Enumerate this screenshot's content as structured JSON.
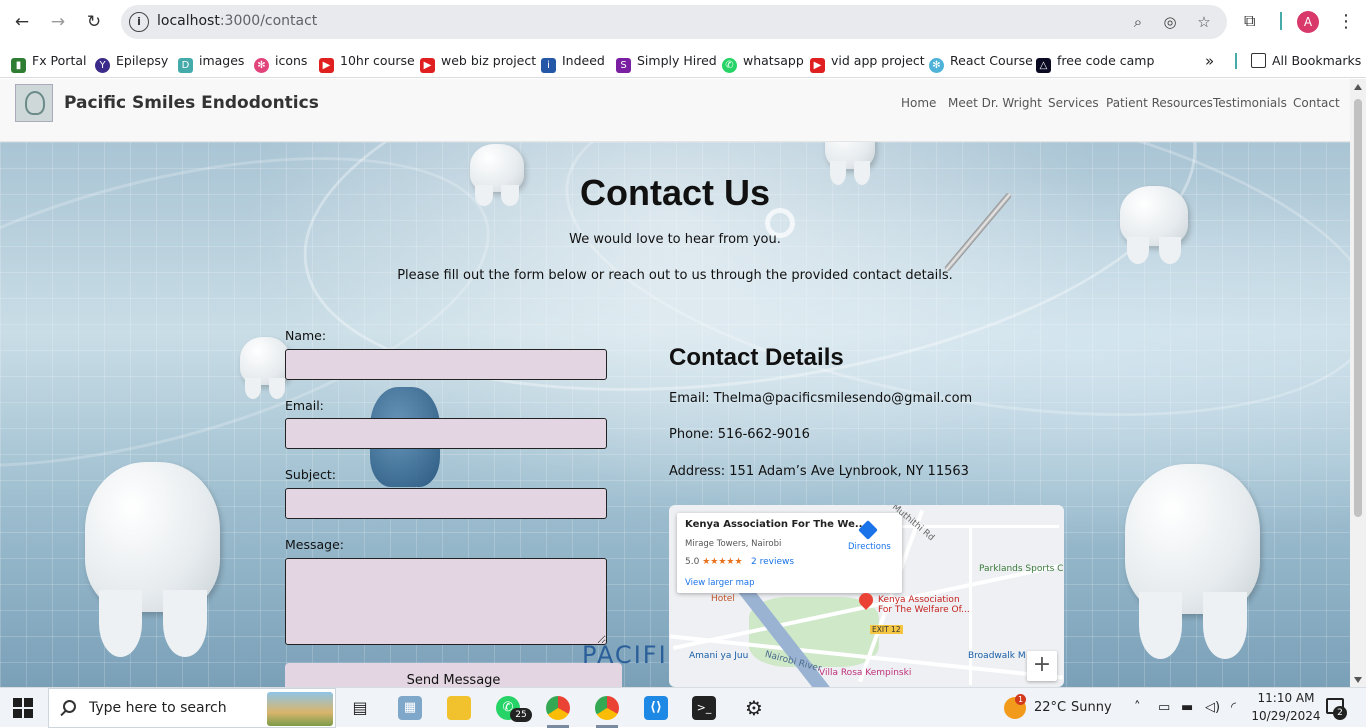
{
  "browser": {
    "url_host": "localhost",
    "url_path": ":3000/contact",
    "profile_initial": "A",
    "bookmarks": [
      {
        "label": "Fx Portal",
        "icon": "bar-chart-icon",
        "color": "#2e7d32"
      },
      {
        "label": "Epilepsy",
        "icon": "yahoo-icon",
        "color": "#3b2a8a"
      },
      {
        "label": "images",
        "icon": "document-icon",
        "color": "#4aa"
      },
      {
        "label": "icons",
        "icon": "react-icon",
        "color": "#e0447a"
      },
      {
        "label": "10hr course",
        "icon": "youtube-icon",
        "color": "#e02020"
      },
      {
        "label": "web biz project",
        "icon": "youtube-icon",
        "color": "#e02020"
      },
      {
        "label": "Indeed",
        "icon": "indeed-icon",
        "color": "#2557a7"
      },
      {
        "label": "Simply Hired",
        "icon": "simplyhired-icon",
        "color": "#7a1fa2"
      },
      {
        "label": "whatsapp",
        "icon": "whatsapp-icon",
        "color": "#25d366"
      },
      {
        "label": "vid app project",
        "icon": "youtube-icon",
        "color": "#e02020"
      },
      {
        "label": "React Course",
        "icon": "react-icon",
        "color": "#4fb3d9"
      },
      {
        "label": "free code camp",
        "icon": "freecodecamp-icon",
        "color": "#0a0a23"
      }
    ],
    "bookmarks_overflow": "»",
    "all_bookmarks": "All Bookmarks"
  },
  "site": {
    "brand": "Pacific Smiles Endodontics",
    "nav": [
      "Home",
      "Meet Dr. Wright",
      "Services",
      "Patient Resources",
      "Testimonials",
      "Contact"
    ]
  },
  "hero": {
    "title": "Contact Us",
    "subtitle_1": "We would love to hear from you.",
    "subtitle_2": "Please fill out the form below or reach out to us through the provided contact details."
  },
  "form": {
    "name_label": "Name:",
    "email_label": "Email:",
    "subject_label": "Subject:",
    "message_label": "Message:",
    "name_value": "",
    "email_value": "",
    "subject_value": "",
    "message_value": "",
    "submit_label": "Send Message"
  },
  "contact": {
    "heading": "Contact Details",
    "email": "Email: Thelma@pacificsmilesendo@gmail.com",
    "phone": "Phone: 516-662-9016",
    "address": "Address: 151 Adam’s Ave Lynbrook, NY 11563"
  },
  "map": {
    "place_name": "Kenya Association For The We...",
    "place_address": "Mirage Towers, Nairobi",
    "rating": "5.0",
    "stars": "★★★★★",
    "reviews": "2 reviews",
    "directions": "Directions",
    "view_larger": "View larger map",
    "labels": {
      "pin": "Kenya Association",
      "pin_2": "For The Welfare Of...",
      "exit": "EXIT 12",
      "hotel": "Hotel",
      "parklands": "Parklands Sports C",
      "amani": "Amani ya Juu",
      "river": "Nairobi River",
      "broadwalk": "Broadwalk M",
      "villa": "Villa Rosa Kempinski",
      "road": "Rd Muthithi Rd"
    },
    "zoom_in": "+",
    "watermark": "PACIFI"
  },
  "taskbar": {
    "search_placeholder": "Type here to search",
    "whatsapp_badge": "25",
    "temperature": "22°C",
    "weather": "Sunny",
    "weather_badge": "1",
    "time": "11:10 AM",
    "date": "10/29/2024",
    "notifications": "2"
  }
}
